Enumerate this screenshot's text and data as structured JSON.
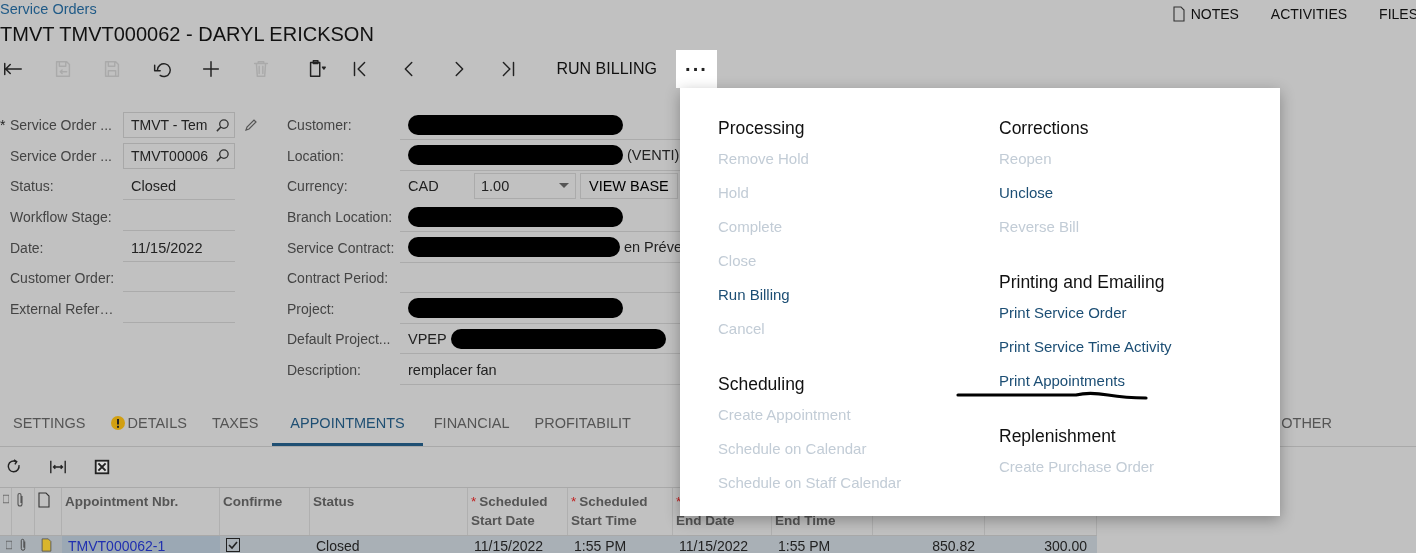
{
  "breadcrumb": "Service Orders",
  "title": "TMVT TMVT000062 - DARYL ERICKSON",
  "top_links": [
    {
      "label": "NOTES",
      "kind": "notes"
    },
    {
      "label": "ACTIVITIES",
      "kind": "plain"
    },
    {
      "label": "FILES",
      "kind": "plain"
    }
  ],
  "toolbar": {
    "buttons": [
      {
        "kind": "back",
        "disabled": false
      },
      {
        "kind": "save-close",
        "disabled": true
      },
      {
        "kind": "save",
        "disabled": true
      },
      {
        "kind": "undo",
        "disabled": false
      },
      {
        "kind": "add",
        "disabled": false
      },
      {
        "kind": "delete",
        "disabled": true
      },
      {
        "kind": "copy",
        "disabled": false
      },
      {
        "kind": "first",
        "disabled": false
      },
      {
        "kind": "prev",
        "disabled": false
      },
      {
        "kind": "next",
        "disabled": false
      },
      {
        "kind": "last",
        "disabled": false
      }
    ],
    "action": "RUN BILLING",
    "more": "···"
  },
  "form": {
    "left": [
      {
        "label": "Service Order ...",
        "marker": "*",
        "kind": "lookup",
        "value": "TMVT - Tem",
        "editable": true
      },
      {
        "label": "Service Order ...",
        "kind": "lookup",
        "value": "TMVT00006",
        "editable": false
      },
      {
        "label": "Status:",
        "kind": "text",
        "value": "Closed",
        "editable": false
      },
      {
        "label": "Workflow Stage:",
        "kind": "text",
        "editable": false
      },
      {
        "label": "Date:",
        "kind": "text",
        "value": "11/15/2022",
        "editable": false
      },
      {
        "label": "Customer Order:",
        "kind": "text",
        "editable": false
      },
      {
        "label": "External Refer…",
        "kind": "text",
        "editable": false
      }
    ],
    "right": [
      {
        "label": "Customer:",
        "kind": "parts",
        "parts": [
          {
            "kind": "redacted"
          }
        ]
      },
      {
        "label": "Location:",
        "kind": "parts",
        "parts": [
          {
            "kind": "redacted"
          },
          {
            "kind": "text",
            "text": "(VENTI)"
          }
        ]
      },
      {
        "label": "Currency:",
        "kind": "currency",
        "value": "CAD",
        "rate": "1.00",
        "button": "VIEW BASE"
      },
      {
        "label": "Branch Location:",
        "kind": "parts",
        "parts": [
          {
            "kind": "redacted"
          }
        ]
      },
      {
        "label": "Service Contract:",
        "kind": "parts",
        "parts": [
          {
            "kind": "redacted"
          },
          {
            "kind": "text",
            "text": "en Préve"
          }
        ]
      },
      {
        "label": "Contract Period:",
        "kind": "parts"
      },
      {
        "label": "Project:",
        "kind": "parts",
        "parts": [
          {
            "kind": "redacted"
          }
        ]
      },
      {
        "label": "Default Project...",
        "kind": "parts",
        "parts": [
          {
            "kind": "text",
            "text": "VPEP"
          },
          {
            "kind": "redacted"
          }
        ]
      },
      {
        "label": "Description:",
        "kind": "parts",
        "parts": [
          {
            "kind": "text",
            "text": "remplacer fan"
          }
        ]
      }
    ]
  },
  "tabs": [
    {
      "label": "SETTINGS",
      "selected": false,
      "warning": false
    },
    {
      "label": "DETAILS",
      "selected": false,
      "warning": true
    },
    {
      "label": "TAXES",
      "selected": false,
      "warning": false
    },
    {
      "label": "APPOINTMENTS",
      "selected": true,
      "warning": false
    },
    {
      "label": "FINANCIAL",
      "selected": false,
      "warning": false
    },
    {
      "label": "PROFITABILIT",
      "selected": false,
      "warning": false
    },
    {
      "label": "OTHER",
      "selected": false,
      "warning": false
    }
  ],
  "grid_toolbar": [
    {
      "kind": "refresh"
    },
    {
      "kind": "fit"
    },
    {
      "kind": "excel"
    }
  ],
  "table": {
    "columns": [
      {
        "kind": "rowmenu"
      },
      {
        "kind": "attach"
      },
      {
        "kind": "note"
      },
      {
        "kind": "text",
        "top": "Appointment Nbr."
      },
      {
        "kind": "text",
        "top": "Confirme"
      },
      {
        "kind": "text",
        "top": "Status"
      },
      {
        "kind": "text",
        "marker": "*",
        "top": "Scheduled",
        "bottom": "Start Date"
      },
      {
        "kind": "text",
        "marker": "*",
        "top": "Scheduled",
        "bottom": "Start Time"
      },
      {
        "kind": "text",
        "marker": "*",
        "bottom": "End Date"
      },
      {
        "kind": "text",
        "bottom": "End Time"
      },
      {
        "kind": "text"
      },
      {
        "kind": "text"
      }
    ],
    "rows": [
      {
        "selected": true,
        "cells": [
          {
            "kind": "rowmenu"
          },
          {
            "kind": "attach"
          },
          {
            "kind": "note"
          },
          {
            "kind": "link",
            "text": "TMVT000062-1"
          },
          {
            "kind": "check",
            "checked": true
          },
          {
            "kind": "text",
            "text": "Closed"
          },
          {
            "kind": "text",
            "text": "11/15/2022"
          },
          {
            "kind": "text",
            "text": "1:55 PM"
          },
          {
            "kind": "text",
            "text": "11/15/2022"
          },
          {
            "kind": "text",
            "text": "1:55 PM"
          },
          {
            "kind": "number",
            "text": "850.82"
          },
          {
            "kind": "number",
            "text": "300.00"
          }
        ]
      }
    ]
  },
  "more_menu": {
    "columns": [
      [
        {
          "title": "Processing",
          "items": [
            {
              "label": "Remove Hold",
              "disabled": true,
              "underlined": false
            },
            {
              "label": "Hold",
              "disabled": true,
              "underlined": false
            },
            {
              "label": "Complete",
              "disabled": true,
              "underlined": false
            },
            {
              "label": "Close",
              "disabled": true,
              "underlined": false
            },
            {
              "label": "Run Billing",
              "disabled": false,
              "underlined": false
            },
            {
              "label": "Cancel",
              "disabled": true,
              "underlined": false
            }
          ]
        },
        {
          "title": "Scheduling",
          "items": [
            {
              "label": "Create Appointment",
              "disabled": true,
              "underlined": false
            },
            {
              "label": "Schedule on Calendar",
              "disabled": true,
              "underlined": false
            },
            {
              "label": "Schedule on Staff Calendar",
              "disabled": true,
              "underlined": false
            }
          ]
        }
      ],
      [
        {
          "title": "Corrections",
          "items": [
            {
              "label": "Reopen",
              "disabled": true,
              "underlined": false
            },
            {
              "label": "Unclose",
              "disabled": false,
              "underlined": false
            },
            {
              "label": "Reverse Bill",
              "disabled": true,
              "underlined": false
            }
          ]
        },
        {
          "title": "Printing and Emailing",
          "items": [
            {
              "label": "Print Service Order",
              "disabled": false,
              "underlined": false
            },
            {
              "label": "Print Service Time Activity",
              "disabled": false,
              "underlined": false
            },
            {
              "label": "Print Appointments",
              "disabled": false,
              "underlined": true
            }
          ]
        },
        {
          "title": "Replenishment",
          "items": [
            {
              "label": "Create Purchase Order",
              "disabled": true,
              "underlined": false
            }
          ]
        }
      ]
    ]
  }
}
